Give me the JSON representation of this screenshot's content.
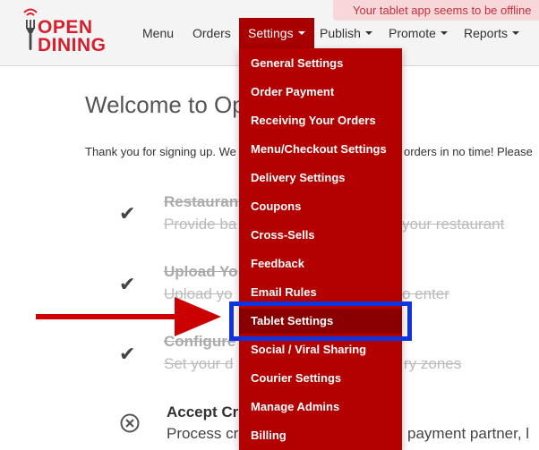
{
  "brand": {
    "line1": "OPEN",
    "line2": "DINING",
    "color": "#d6202e"
  },
  "alert": {
    "text": "Your tablet app seems to be offline"
  },
  "nav": {
    "menu": "Menu",
    "orders": "Orders",
    "settings": "Settings",
    "publish": "Publish",
    "promote": "Promote",
    "reports": "Reports"
  },
  "page": {
    "welcome": "Welcome to Op",
    "thanks_left": "Thank you for signing up. We",
    "thanks_right": "orders in no time! Please"
  },
  "steps": [
    {
      "title": "Restaurant",
      "desc_left": "Provide ba",
      "desc_right": "your restaurant",
      "status": "done",
      "icon": "check-icon"
    },
    {
      "title": "Upload Yo",
      "desc_left": "Upload yo",
      "desc_right": "o enter",
      "status": "done",
      "icon": "check-icon"
    },
    {
      "title": "Configure",
      "desc_left": "Set your d",
      "desc_right": "ry zones",
      "status": "done",
      "icon": "check-icon"
    },
    {
      "title": "Accept Cr",
      "desc_left": "Process cr",
      "desc_right": "payment partner, l",
      "status": "pending",
      "icon": "x-circle-icon"
    }
  ],
  "dropdown": {
    "items": [
      "General Settings",
      "Order Payment",
      "Receiving Your Orders",
      "Menu/Checkout Settings",
      "Delivery Settings",
      "Coupons",
      "Cross-Sells",
      "Feedback",
      "Email Rules",
      "Tablet Settings",
      "Social / Viral Sharing",
      "Courier Settings",
      "Manage Admins",
      "Billing"
    ],
    "highlighted": "Tablet Settings"
  },
  "colors": {
    "accent": "#b30000",
    "highlight_box": "#1133dd",
    "arrow": "#cc0000"
  }
}
